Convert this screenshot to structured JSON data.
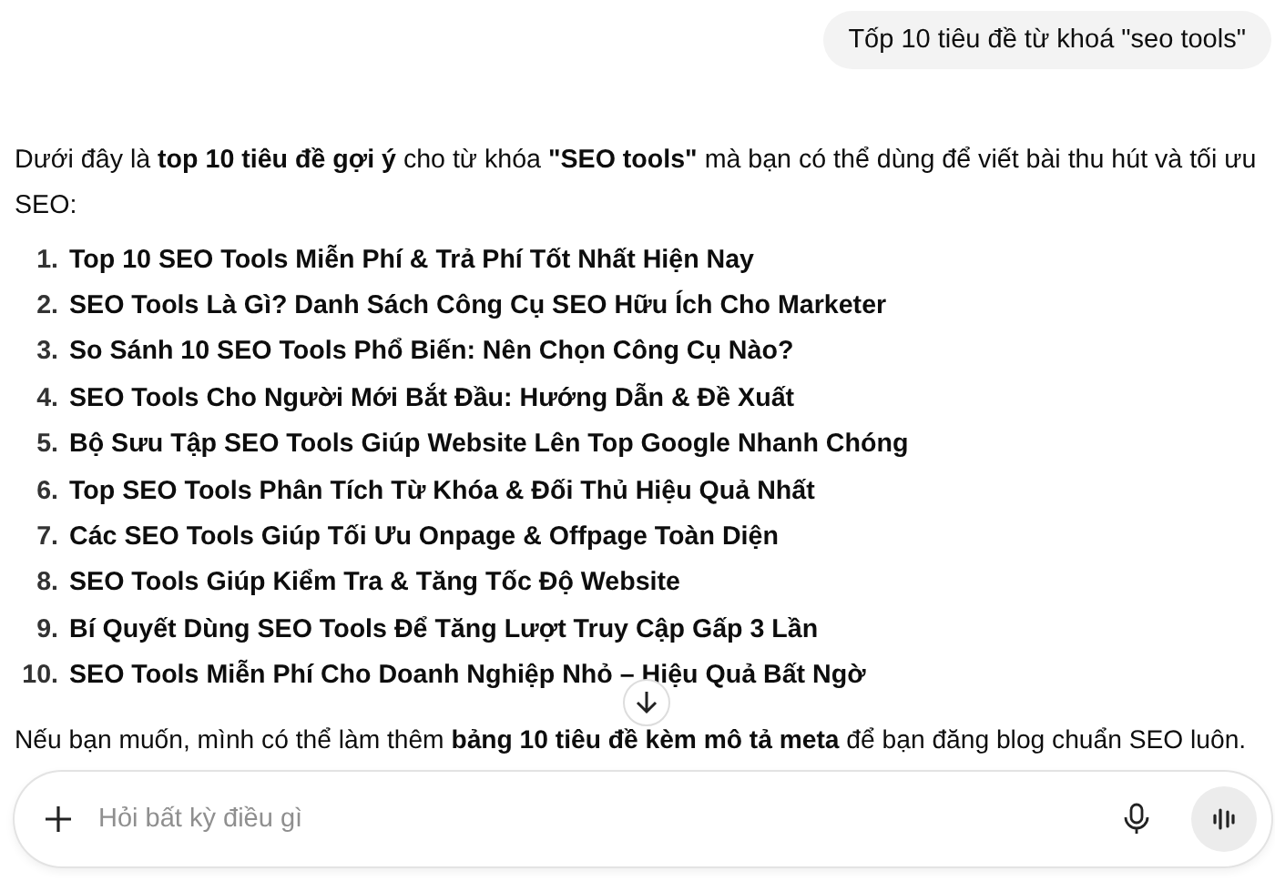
{
  "user_message": "Tốp 10 tiêu đề từ khoá \"seo tools\"",
  "response": {
    "intro": "Dưới đây là **top 10 tiêu đề gợi ý** cho từ khóa **\"SEO tools\"** mà bạn có thể dùng để viết bài thu hút và tối ưu SEO:",
    "items": [
      {
        "number": "1.",
        "text": "Top 10 SEO Tools Miễn Phí & Trả Phí Tốt Nhất Hiện Nay"
      },
      {
        "number": "2.",
        "text": "SEO Tools Là Gì? Danh Sách Công Cụ SEO Hữu Ích Cho Marketer"
      },
      {
        "number": "3.",
        "text": "So Sánh 10 SEO Tools Phổ Biến: Nên Chọn Công Cụ Nào?"
      },
      {
        "number": "4.",
        "text": "SEO Tools Cho Người Mới Bắt Đầu: Hướng Dẫn & Đề Xuất"
      },
      {
        "number": "5.",
        "text": "Bộ Sưu Tập SEO Tools Giúp Website Lên Top Google Nhanh Chóng"
      },
      {
        "number": "6.",
        "text": "Top SEO Tools Phân Tích Từ Khóa & Đối Thủ Hiệu Quả Nhất"
      },
      {
        "number": "7.",
        "text": "Các SEO Tools Giúp Tối Ưu Onpage & Offpage Toàn Diện"
      },
      {
        "number": "8.",
        "text": "SEO Tools Giúp Kiểm Tra & Tăng Tốc Độ Website"
      },
      {
        "number": "9.",
        "text": "Bí Quyết Dùng SEO Tools Để Tăng Lượt Truy Cập Gấp 3 Lần"
      },
      {
        "number": "10.",
        "text": "SEO Tools Miễn Phí Cho Doanh Nghiệp Nhỏ – Hiệu Quả Bất Ngờ"
      }
    ],
    "outro": "Nếu bạn muốn, mình có thể làm thêm **bảng 10 tiêu đề kèm mô tả meta** để bạn đăng blog chuẩn SEO luôn."
  },
  "composer": {
    "placeholder": "Hỏi bất kỳ điều gì"
  }
}
